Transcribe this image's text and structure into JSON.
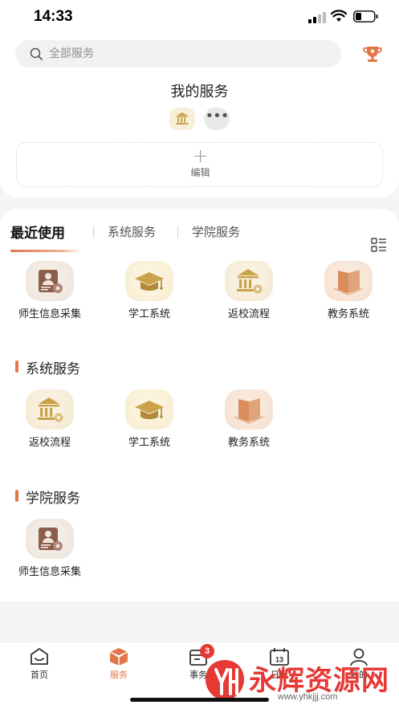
{
  "status_bar": {
    "time": "14:33"
  },
  "search": {
    "placeholder": "全部服务"
  },
  "my_services": {
    "title": "我的服务",
    "more": "•••",
    "edit_label": "编辑",
    "add_symbol": "+"
  },
  "tabs": [
    {
      "label": "最近使用",
      "active": true
    },
    {
      "label": "系统服务",
      "active": false
    },
    {
      "label": "学院服务",
      "active": false
    }
  ],
  "recent": [
    {
      "label": "师生信息采集",
      "icon": "teacher-student-info-icon"
    },
    {
      "label": "学工系统",
      "icon": "graduation-cap-icon"
    },
    {
      "label": "返校流程",
      "icon": "school-building-icon"
    },
    {
      "label": "教务系统",
      "icon": "book-icon"
    }
  ],
  "system_section": {
    "title": "系统服务",
    "items": [
      {
        "label": "返校流程",
        "icon": "school-building-icon"
      },
      {
        "label": "学工系统",
        "icon": "graduation-cap-icon"
      },
      {
        "label": "教务系统",
        "icon": "book-icon"
      }
    ]
  },
  "college_section": {
    "title": "学院服务",
    "items": [
      {
        "label": "师生信息采集",
        "icon": "teacher-student-info-icon"
      }
    ]
  },
  "tabbar": [
    {
      "label": "首页",
      "icon": "home-icon",
      "active": false
    },
    {
      "label": "服务",
      "icon": "service-box-icon",
      "active": true
    },
    {
      "label": "事务",
      "icon": "task-icon",
      "active": false,
      "badge": "3"
    },
    {
      "label": "日程",
      "icon": "calendar-icon",
      "active": false,
      "calendar_day": "13"
    },
    {
      "label": "我的",
      "icon": "user-icon",
      "active": false
    }
  ],
  "watermark": {
    "text": "永辉资源网",
    "url": "www.yhkjjj.com"
  },
  "colors": {
    "accent": "#e0764a",
    "badge": "#e53935",
    "gold": "#c9a24a"
  }
}
